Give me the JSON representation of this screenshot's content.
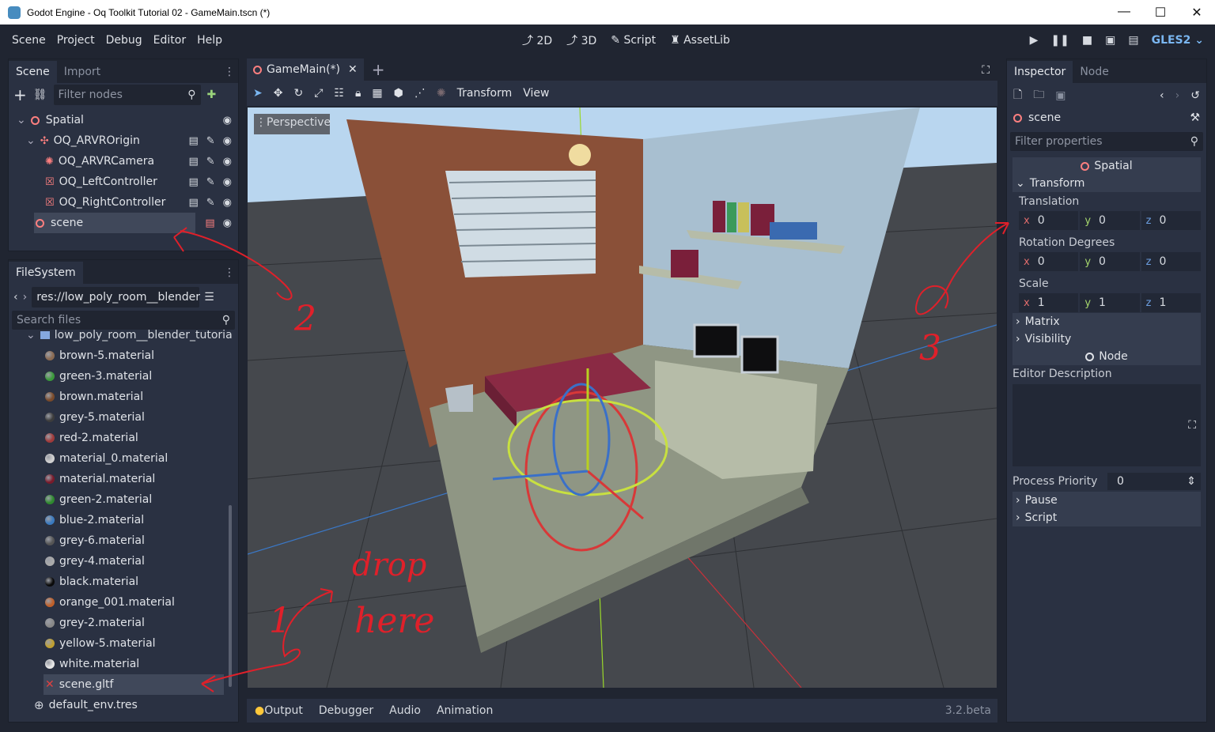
{
  "window": {
    "title": "Godot Engine - Oq Toolkit Tutorial 02 - GameMain.tscn (*)",
    "controls": [
      "—",
      "☐",
      "✕"
    ]
  },
  "menubar": {
    "menus": [
      "Scene",
      "Project",
      "Debug",
      "Editor",
      "Help"
    ],
    "modes": [
      {
        "label": "2D"
      },
      {
        "label": "3D"
      },
      {
        "label": "Script"
      },
      {
        "label": "AssetLib"
      }
    ],
    "renderer": "GLES2"
  },
  "scene_dock": {
    "tabs": [
      "Scene",
      "Import"
    ],
    "filter_placeholder": "Filter nodes",
    "nodes": [
      {
        "label": "Spatial"
      },
      {
        "label": "OQ_ARVROrigin"
      },
      {
        "label": "OQ_ARVRCamera"
      },
      {
        "label": "OQ_LeftController"
      },
      {
        "label": "OQ_RightController"
      },
      {
        "label": "scene"
      }
    ]
  },
  "filesystem_dock": {
    "title": "FileSystem",
    "path": "res://low_poly_room__blender",
    "search_placeholder": "Search files",
    "folder": "low_poly_room__blender_tutoria",
    "files": [
      {
        "label": "brown-5.material",
        "color": "#8a6a52"
      },
      {
        "label": "green-3.material",
        "color": "#3a9a3a"
      },
      {
        "label": "brown.material",
        "color": "#7a4a2a"
      },
      {
        "label": "grey-5.material",
        "color": "#3c3c3c"
      },
      {
        "label": "red-2.material",
        "color": "#a03a3a"
      },
      {
        "label": "material_0.material",
        "color": "#d0d0d0"
      },
      {
        "label": "material.material",
        "color": "#7a1a2a"
      },
      {
        "label": "green-2.material",
        "color": "#2e8a2e"
      },
      {
        "label": "blue-2.material",
        "color": "#3a7ac0"
      },
      {
        "label": "grey-6.material",
        "color": "#555"
      },
      {
        "label": "grey-4.material",
        "color": "#aaa"
      },
      {
        "label": "black.material",
        "color": "#0a0a0a"
      },
      {
        "label": "orange_001.material",
        "color": "#c0602a"
      },
      {
        "label": "grey-2.material",
        "color": "#888"
      },
      {
        "label": "yellow-5.material",
        "color": "#c0a030"
      },
      {
        "label": "white.material",
        "color": "#e6e6e6"
      },
      {
        "label": "scene.gltf",
        "color": "#e04040"
      },
      {
        "label": "default_env.tres",
        "color": "#cfd3da"
      }
    ]
  },
  "editor": {
    "tab": "GameMain(*)",
    "toolbar": {
      "transform": "Transform",
      "view": "View"
    },
    "viewport_label": "Perspective",
    "annotations": {
      "drop": "drop",
      "here": "here",
      "n1": "1",
      "n2": "2",
      "n3": "3"
    }
  },
  "bottom_panel": {
    "tabs": [
      "Output",
      "Debugger",
      "Audio",
      "Animation"
    ],
    "version": "3.2.beta"
  },
  "inspector": {
    "tabs": [
      "Inspector",
      "Node"
    ],
    "object": "scene",
    "filter_placeholder": "Filter properties",
    "class_header": "Spatial",
    "transform_section": "Transform",
    "translation": {
      "label": "Translation",
      "x": "0",
      "y": "0",
      "z": "0"
    },
    "rotation": {
      "label": "Rotation Degrees",
      "x": "0",
      "y": "0",
      "z": "0"
    },
    "scale": {
      "label": "Scale",
      "x": "1",
      "y": "1",
      "z": "1"
    },
    "matrix": "Matrix",
    "visibility": "Visibility",
    "node_header": "Node",
    "editor_description": "Editor Description",
    "process_priority": {
      "label": "Process Priority",
      "value": "0"
    },
    "pause": "Pause",
    "script": "Script",
    "axis_labels": {
      "x": "x",
      "y": "y",
      "z": "z"
    }
  }
}
